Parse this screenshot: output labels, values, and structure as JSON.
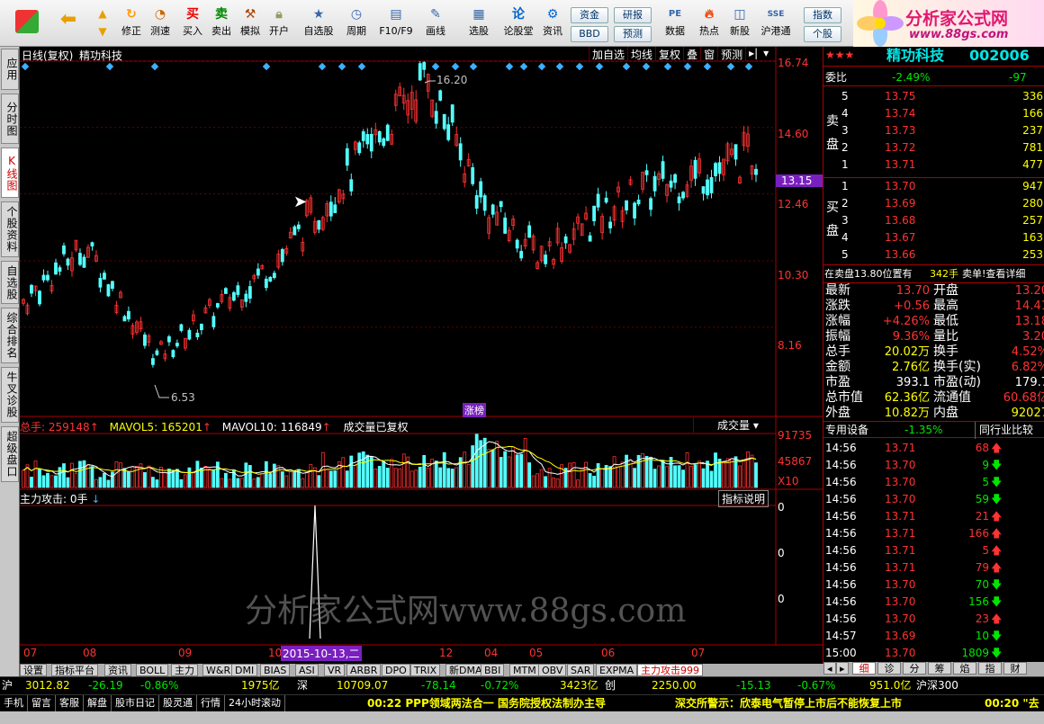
{
  "toolbar": {
    "buttons": [
      "修正",
      "测速",
      "买入",
      "卖出",
      "模拟",
      "开户",
      "自选股",
      "周期",
      "F10/F9",
      "画线",
      "选股",
      "论股堂",
      "资讯",
      "数据",
      "热点",
      "新股",
      "沪港通"
    ],
    "small": [
      "资金",
      "研报",
      "BBD",
      "预测",
      "指数",
      "个股"
    ],
    "logo_title": "分析家公式网",
    "logo_url": "www.88gs.com"
  },
  "left_tabs": [
    "应用",
    "分时图",
    "K线图",
    "个股资料",
    "自选股",
    "综合排名",
    "牛叉诊股",
    "超级盘口"
  ],
  "chart": {
    "header_left": "日线(复权)",
    "stock": "精功科技",
    "header_buttons": [
      "加自选",
      "均线",
      "复权",
      "叠",
      "窗",
      "预测"
    ],
    "price_ticks": [
      "16.74",
      "14.60",
      "12.46",
      "10.30",
      "8.16"
    ],
    "current_price_tag": "13.15",
    "high_label": "16.20",
    "low_label": "6.53",
    "event_tag": "涨榜",
    "vol_header": {
      "total_label": "总手:",
      "total": "259148",
      "mavol5_label": "MAVOL5:",
      "mavol5": "165201",
      "mavol10_label": "MAVOL10:",
      "mavol10": "116849",
      "note": "成交量已复权",
      "select": "成交量"
    },
    "vol_ticks": [
      "91735",
      "45867",
      "X10"
    ],
    "ind_header": "主力攻击: 0手",
    "ind_button": "指标说明",
    "ind_ticks": [
      "0",
      "0",
      "0"
    ],
    "date_ticks": [
      "07",
      "08",
      "09",
      "10",
      "12",
      "04",
      "05",
      "06",
      "07"
    ],
    "date_highlight": "2015-10-13,二",
    "watermark": "分析家公式网www.88gs.com"
  },
  "chart_data": {
    "type": "candlestick",
    "title": "精功科技 日线(复权)",
    "ylim": [
      6.53,
      16.74
    ],
    "high": 16.2,
    "low": 6.53,
    "last": 13.7,
    "key_points": [
      {
        "x": "07",
        "y": 9.0
      },
      {
        "x": "08",
        "y": 10.8
      },
      {
        "x": "09",
        "y": 7.2
      },
      {
        "x": "10",
        "y": 10.3
      },
      {
        "x": "12",
        "y": 16.2
      },
      {
        "x": "04",
        "y": 12.0
      },
      {
        "x": "05",
        "y": 10.5
      },
      {
        "x": "06",
        "y": 12.4
      },
      {
        "x": "07",
        "y": 13.7
      }
    ]
  },
  "quote": {
    "stars": "★★★",
    "name": "精功科技",
    "code": "002006",
    "webi_label": "委比",
    "webi": "-2.49%",
    "webi_diff": "-97",
    "sell_label": "卖盘",
    "buy_label": "买盘",
    "asks": [
      {
        "n": "5",
        "p": "13.75",
        "v": "336"
      },
      {
        "n": "4",
        "p": "13.74",
        "v": "166"
      },
      {
        "n": "3",
        "p": "13.73",
        "v": "237"
      },
      {
        "n": "2",
        "p": "13.72",
        "v": "781"
      },
      {
        "n": "1",
        "p": "13.71",
        "v": "477"
      }
    ],
    "bids": [
      {
        "n": "1",
        "p": "13.70",
        "v": "947"
      },
      {
        "n": "2",
        "p": "13.69",
        "v": "280"
      },
      {
        "n": "3",
        "p": "13.68",
        "v": "257"
      },
      {
        "n": "4",
        "p": "13.67",
        "v": "163"
      },
      {
        "n": "5",
        "p": "13.66",
        "v": "253"
      }
    ],
    "note": "在卖盘13.80位置有",
    "note_vol": "342手",
    "note_tail": "卖单!查看详细",
    "stats": [
      {
        "l1": "最新",
        "v1": "13.70",
        "l2": "开盘",
        "v2": "13.20"
      },
      {
        "l1": "涨跌",
        "v1": "+0.56",
        "l2": "最高",
        "v2": "14.41"
      },
      {
        "l1": "涨幅",
        "v1": "+4.26%",
        "l2": "最低",
        "v2": "13.18"
      },
      {
        "l1": "振幅",
        "v1": "9.36%",
        "l2": "量比",
        "v2": "3.20"
      },
      {
        "l1": "总手",
        "v1": "20.02万",
        "l2": "换手",
        "v2": "4.52%"
      },
      {
        "l1": "金额",
        "v1": "2.76亿",
        "l2": "换手(实)",
        "v2": "6.82%"
      },
      {
        "l1": "市盈",
        "v1": "393.1",
        "l2": "市盈(动)",
        "v2": "179.7"
      },
      {
        "l1": "总市值",
        "v1": "62.36亿",
        "l2": "流通值",
        "v2": "60.68亿"
      },
      {
        "l1": "外盘",
        "v1": "10.82万",
        "l2": "内盘",
        "v2": "92027"
      }
    ],
    "sector_label": "专用设备",
    "sector_pct": "-1.35%",
    "sector_btn": "同行业比较",
    "ticks": [
      {
        "t": "14:56",
        "p": "13.71",
        "v": "68",
        "d": "up"
      },
      {
        "t": "14:56",
        "p": "13.70",
        "v": "9",
        "d": "dn"
      },
      {
        "t": "14:56",
        "p": "13.70",
        "v": "5",
        "d": "dn"
      },
      {
        "t": "14:56",
        "p": "13.70",
        "v": "59",
        "d": "dn"
      },
      {
        "t": "14:56",
        "p": "13.71",
        "v": "21",
        "d": "up"
      },
      {
        "t": "14:56",
        "p": "13.71",
        "v": "166",
        "d": "up"
      },
      {
        "t": "14:56",
        "p": "13.71",
        "v": "5",
        "d": "up"
      },
      {
        "t": "14:56",
        "p": "13.71",
        "v": "79",
        "d": "up"
      },
      {
        "t": "14:56",
        "p": "13.70",
        "v": "70",
        "d": "dn"
      },
      {
        "t": "14:56",
        "p": "13.70",
        "v": "156",
        "d": "dn"
      },
      {
        "t": "14:56",
        "p": "13.70",
        "v": "23",
        "d": "up"
      },
      {
        "t": "14:57",
        "p": "13.69",
        "v": "10",
        "d": "dn"
      },
      {
        "t": "15:00",
        "p": "13.70",
        "v": "1809",
        "d": "dn"
      }
    ],
    "right_tabs": [
      "细",
      "诊",
      "分",
      "筹",
      "焰",
      "指",
      "财"
    ]
  },
  "bottom_tabs": [
    "设置",
    "指标平台",
    "资讯",
    "BOLL",
    "主力",
    "W&R",
    "DMI",
    "BIAS",
    "ASI",
    "VR",
    "ARBR",
    "DPO",
    "TRIX",
    "新DMA",
    "BBI",
    "MTM",
    "OBV",
    "SAR",
    "EXPMA",
    "主力攻击999"
  ],
  "status": {
    "sh": "沪",
    "sh_idx": "3012.82",
    "sh_chg": "-26.19",
    "sh_pct": "-0.86%",
    "sh_amt": "1975亿",
    "sz": "深",
    "sz_idx": "10709.07",
    "sz_chg": "-78.14",
    "sz_pct": "-0.72%",
    "sz_amt": "3423亿",
    "cy": "创",
    "cy_idx": "2250.00",
    "cy_chg": "-15.13",
    "cy_pct": "-0.67%",
    "cy_amt": "951.0亿",
    "hs": "沪深300"
  },
  "status2": {
    "items": [
      "手机",
      "留言",
      "客服",
      "解盘",
      "股市日记",
      "股灵通",
      "行情",
      "24小时滚动"
    ],
    "news1": "00:22 PPP领域两法合一 国务院授权法制办主导",
    "news2": "深交所警示：欣泰电气暂停上市后不能恢复上市",
    "news3": "00:20 \"去"
  }
}
